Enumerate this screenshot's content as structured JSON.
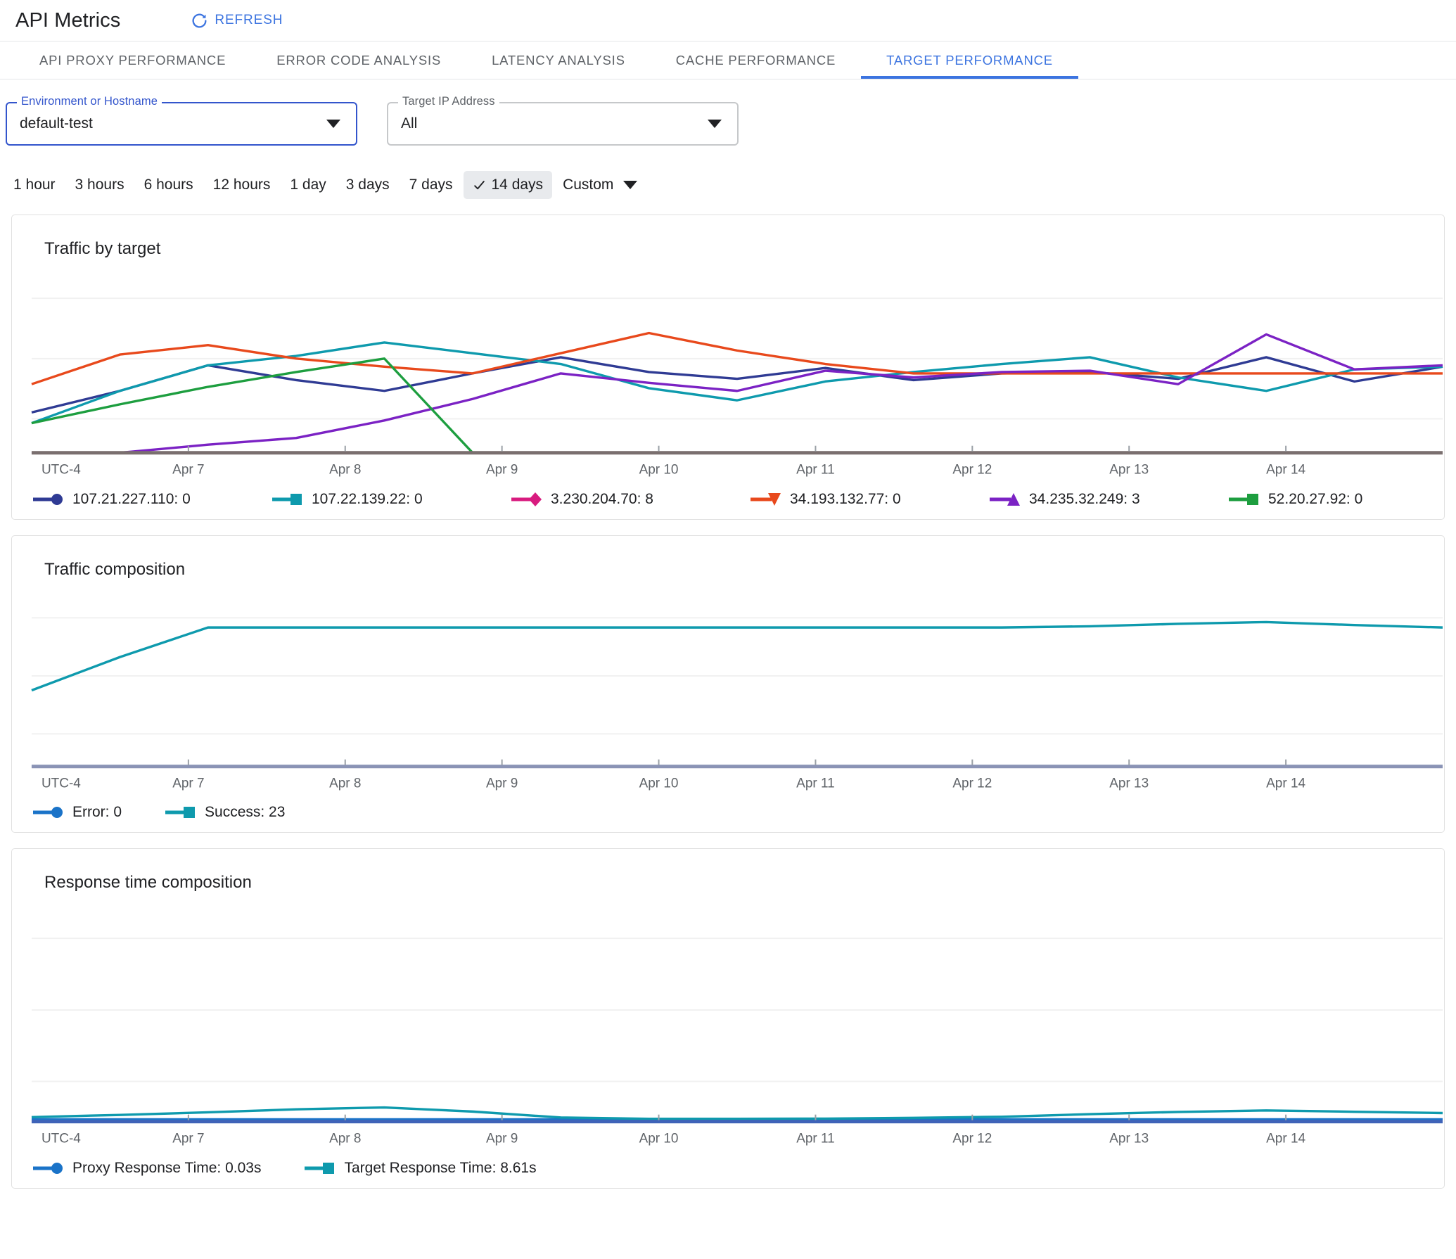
{
  "header": {
    "title": "API Metrics",
    "refresh_label": "REFRESH",
    "refresh_icon": "refresh-icon"
  },
  "tabs": [
    {
      "label": "API PROXY PERFORMANCE",
      "active": false
    },
    {
      "label": "ERROR CODE ANALYSIS",
      "active": false
    },
    {
      "label": "LATENCY ANALYSIS",
      "active": false
    },
    {
      "label": "CACHE PERFORMANCE",
      "active": false
    },
    {
      "label": "TARGET PERFORMANCE",
      "active": true
    }
  ],
  "filters": {
    "environment": {
      "label": "Environment or Hostname",
      "value": "default-test",
      "focused": true
    },
    "target_ip": {
      "label": "Target IP Address",
      "value": "All",
      "focused": false
    }
  },
  "time_range": {
    "options": [
      "1 hour",
      "3 hours",
      "6 hours",
      "12 hours",
      "1 day",
      "3 days",
      "7 days",
      "14 days"
    ],
    "selected": "14 days",
    "custom_label": "Custom"
  },
  "colors": {
    "accent": "#3c74e0",
    "series_blue": "#2f3b94",
    "series_teal": "#0e9aad",
    "series_pink": "#d81b7f",
    "series_orange": "#e8491c",
    "series_purple": "#7b22c4",
    "series_green": "#1d9e3f",
    "axis": "#7a6f6f",
    "grid": "#f1f1f1",
    "error_blue": "#1a73c8",
    "success_teal": "#0e9aad"
  },
  "chart_data": [
    {
      "id": "traffic-by-target",
      "type": "line",
      "title": "Traffic by target",
      "xlabel": "",
      "ylabel": "",
      "tz_label": "UTC-4",
      "x_ticks": [
        "Apr 7",
        "Apr 8",
        "Apr 9",
        "Apr 10",
        "Apr 11",
        "Apr 12",
        "Apr 13",
        "Apr 14"
      ],
      "grid": true,
      "legend_position": "bottom",
      "ylim": [
        0,
        14
      ],
      "x": [
        0,
        1,
        2,
        3,
        4,
        5,
        6,
        7,
        8,
        9,
        10,
        11,
        12,
        13,
        14,
        15,
        16
      ],
      "series": [
        {
          "name": "107.21.227.110",
          "last_value": 0,
          "label": "107.21.227.110: 0",
          "color": "#2f3b94",
          "marker": "circle",
          "values": [
            3.0,
            4.6,
            6.5,
            5.4,
            4.6,
            5.9,
            7.1,
            6.0,
            5.5,
            6.3,
            5.4,
            5.9,
            6.0,
            5.5,
            7.1,
            5.3,
            6.4
          ]
        },
        {
          "name": "107.22.139.22",
          "last_value": 0,
          "label": "107.22.139.22: 0",
          "color": "#0e9aad",
          "marker": "square",
          "values": [
            2.2,
            4.6,
            6.5,
            7.2,
            8.2,
            7.4,
            6.6,
            4.8,
            3.9,
            5.3,
            6.0,
            6.6,
            7.1,
            5.6,
            4.6,
            6.2,
            6.4
          ]
        },
        {
          "name": "3.230.204.70",
          "last_value": 8,
          "label": "3.230.204.70: 8",
          "color": "#d81b7f",
          "marker": "diamond",
          "values": []
        },
        {
          "name": "34.193.132.77",
          "last_value": 0,
          "label": "34.193.132.77: 0",
          "color": "#e8491c",
          "marker": "triangle-down",
          "values": [
            5.1,
            7.3,
            8.0,
            7.0,
            6.4,
            5.9,
            7.4,
            8.9,
            7.6,
            6.6,
            5.9,
            5.9,
            5.9,
            5.9,
            5.9,
            5.9,
            5.9
          ]
        },
        {
          "name": "34.235.32.249",
          "last_value": 3,
          "label": "34.235.32.249: 3",
          "color": "#7b22c4",
          "marker": "triangle-up",
          "values": [
            0.0,
            0.0,
            0.6,
            1.1,
            2.4,
            4.0,
            5.9,
            5.2,
            4.6,
            6.1,
            5.6,
            6.0,
            6.1,
            5.1,
            8.8,
            6.2,
            6.5
          ]
        },
        {
          "name": "52.20.27.92",
          "last_value": 0,
          "label": "52.20.27.92: 0",
          "color": "#1d9e3f",
          "marker": "square",
          "values": [
            2.2,
            3.6,
            4.9,
            6.0,
            7.0,
            0.0
          ]
        },
        {
          "name": "",
          "last_value": null,
          "label": "",
          "color": "#2f3b94",
          "marker": "square",
          "values": []
        }
      ]
    },
    {
      "id": "traffic-composition",
      "type": "line",
      "title": "Traffic composition",
      "xlabel": "",
      "ylabel": "",
      "tz_label": "UTC-4",
      "x_ticks": [
        "Apr 7",
        "Apr 8",
        "Apr 9",
        "Apr 10",
        "Apr 11",
        "Apr 12",
        "Apr 13",
        "Apr 14"
      ],
      "grid": true,
      "legend_position": "bottom",
      "ylim": [
        0,
        30
      ],
      "series": [
        {
          "name": "Error",
          "last_value": 0,
          "label": "Error:  0",
          "color": "#1a73c8",
          "marker": "circle",
          "values": [
            0,
            0,
            0,
            0,
            0,
            0,
            0,
            0,
            0,
            0,
            0,
            0,
            0,
            0,
            0,
            0,
            0
          ]
        },
        {
          "name": "Success",
          "last_value": 23,
          "label": "Success: 23",
          "color": "#0e9aad",
          "marker": "square",
          "values": [
            12.6,
            18.1,
            23.0,
            23.0,
            23.0,
            23.0,
            23.0,
            23.0,
            23.0,
            23.0,
            23.0,
            23.0,
            23.2,
            23.6,
            23.9,
            23.4,
            23.0
          ]
        }
      ]
    },
    {
      "id": "response-time-composition",
      "type": "line",
      "title": "Response time composition",
      "xlabel": "",
      "ylabel": "",
      "tz_label": "UTC-4",
      "x_ticks": [
        "Apr 7",
        "Apr 8",
        "Apr 9",
        "Apr 10",
        "Apr 11",
        "Apr 12",
        "Apr 13",
        "Apr 14"
      ],
      "grid": true,
      "legend_position": "bottom",
      "ylim": [
        0,
        120
      ],
      "series": [
        {
          "name": "Proxy Response Time",
          "last_value": "0.03s",
          "label": "Proxy Response Time: 0.03s",
          "color": "#1a73c8",
          "marker": "circle",
          "values": [
            1.2,
            1.2,
            1.2,
            1.2,
            1.2,
            1.2,
            1.2,
            1.2,
            1.2,
            1.2,
            1.2,
            1.2,
            1.2,
            1.2,
            1.2,
            1.2,
            1.2
          ]
        },
        {
          "name": "Target Response Time",
          "last_value": "8.61s",
          "label": "Target Response Time: 8.61s",
          "color": "#0e9aad",
          "marker": "square",
          "values": [
            2.4,
            3.6,
            5.0,
            6.6,
            7.6,
            5.4,
            2.2,
            1.5,
            1.5,
            1.6,
            2.0,
            2.6,
            4.0,
            5.2,
            6.0,
            5.3,
            4.6
          ]
        }
      ]
    }
  ]
}
